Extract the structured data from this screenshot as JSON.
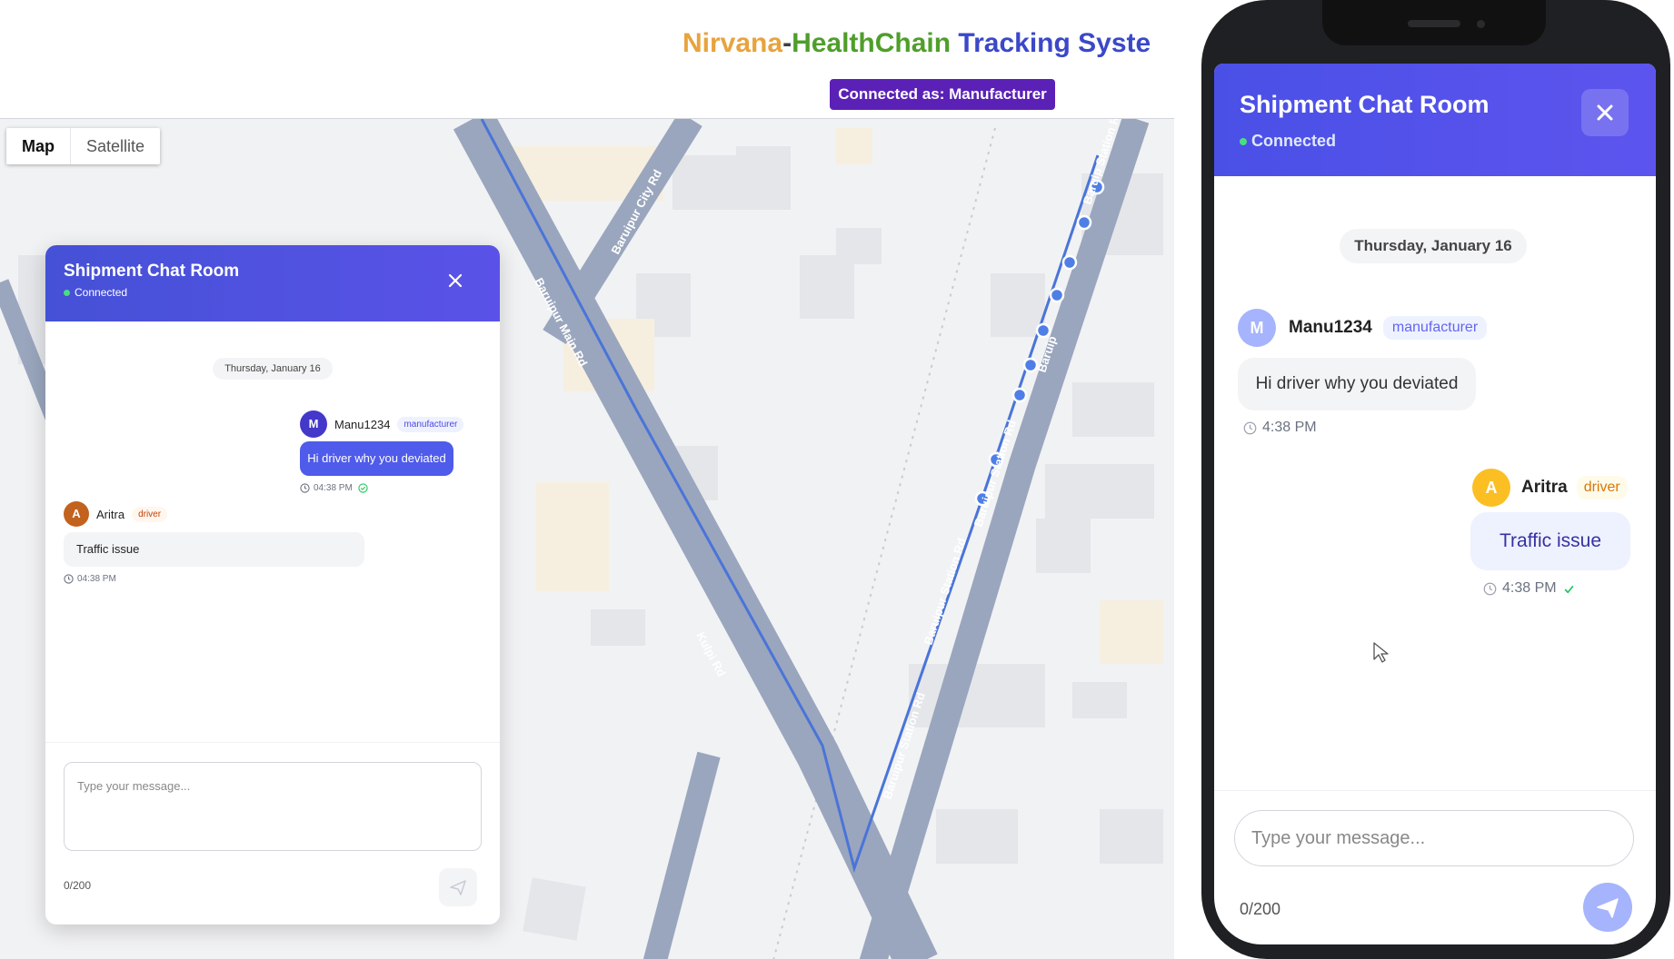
{
  "header": {
    "title_part1": "Nirvana",
    "title_part2": "-",
    "title_part3": "HealthChain",
    "title_part4": " Tracking Syste",
    "connection_badge": "Connected as: Manufacturer"
  },
  "map": {
    "type_controls": [
      "Map",
      "Satellite"
    ],
    "active_type": "Map",
    "road_labels": [
      "Baruipur City Rd",
      "Baruipur Main Rd",
      "Kulpi Rd",
      "Baruipur Station Rd",
      "Baruipur Station Rd",
      "Baruipur Station Rd",
      "Baruip",
      "Baruip Station Rd"
    ],
    "route_point_count": 9,
    "colors": {
      "route": "#4a74d9",
      "road": "#9aa6bd",
      "waypoint": "#4f7fe6"
    }
  },
  "desktop_chat": {
    "title": "Shipment Chat Room",
    "status": "Connected",
    "date": "Thursday, January 16",
    "messages": [
      {
        "sender": "Manu1234",
        "initial": "M",
        "role": "manufacturer",
        "text": "Hi driver why you deviated",
        "time": "04:38 PM",
        "align": "right",
        "status_icon": "check-circle-icon"
      },
      {
        "sender": "Aritra",
        "initial": "A",
        "role": "driver",
        "text": "Traffic issue",
        "time": "04:38 PM",
        "align": "left"
      }
    ],
    "input_placeholder": "Type your message...",
    "counter": "0/200"
  },
  "phone_chat": {
    "title": "Shipment Chat Room",
    "status": "Connected",
    "date": "Thursday, January 16",
    "messages": [
      {
        "sender": "Manu1234",
        "initial": "M",
        "role": "manufacturer",
        "text": "Hi driver why you deviated",
        "time": "4:38 PM",
        "align": "left"
      },
      {
        "sender": "Aritra",
        "initial": "A",
        "role": "driver",
        "text": "Traffic issue",
        "time": "4:38 PM",
        "align": "right",
        "status_icon": "check-icon"
      }
    ],
    "input_placeholder": "Type your message...",
    "counter": "0/200"
  },
  "colors": {
    "brand": "#4f52e0",
    "manufacturer_badge": "#5b21b6",
    "driver_avatar": "#d97706",
    "manufacturer_avatar": "#4338ca"
  }
}
